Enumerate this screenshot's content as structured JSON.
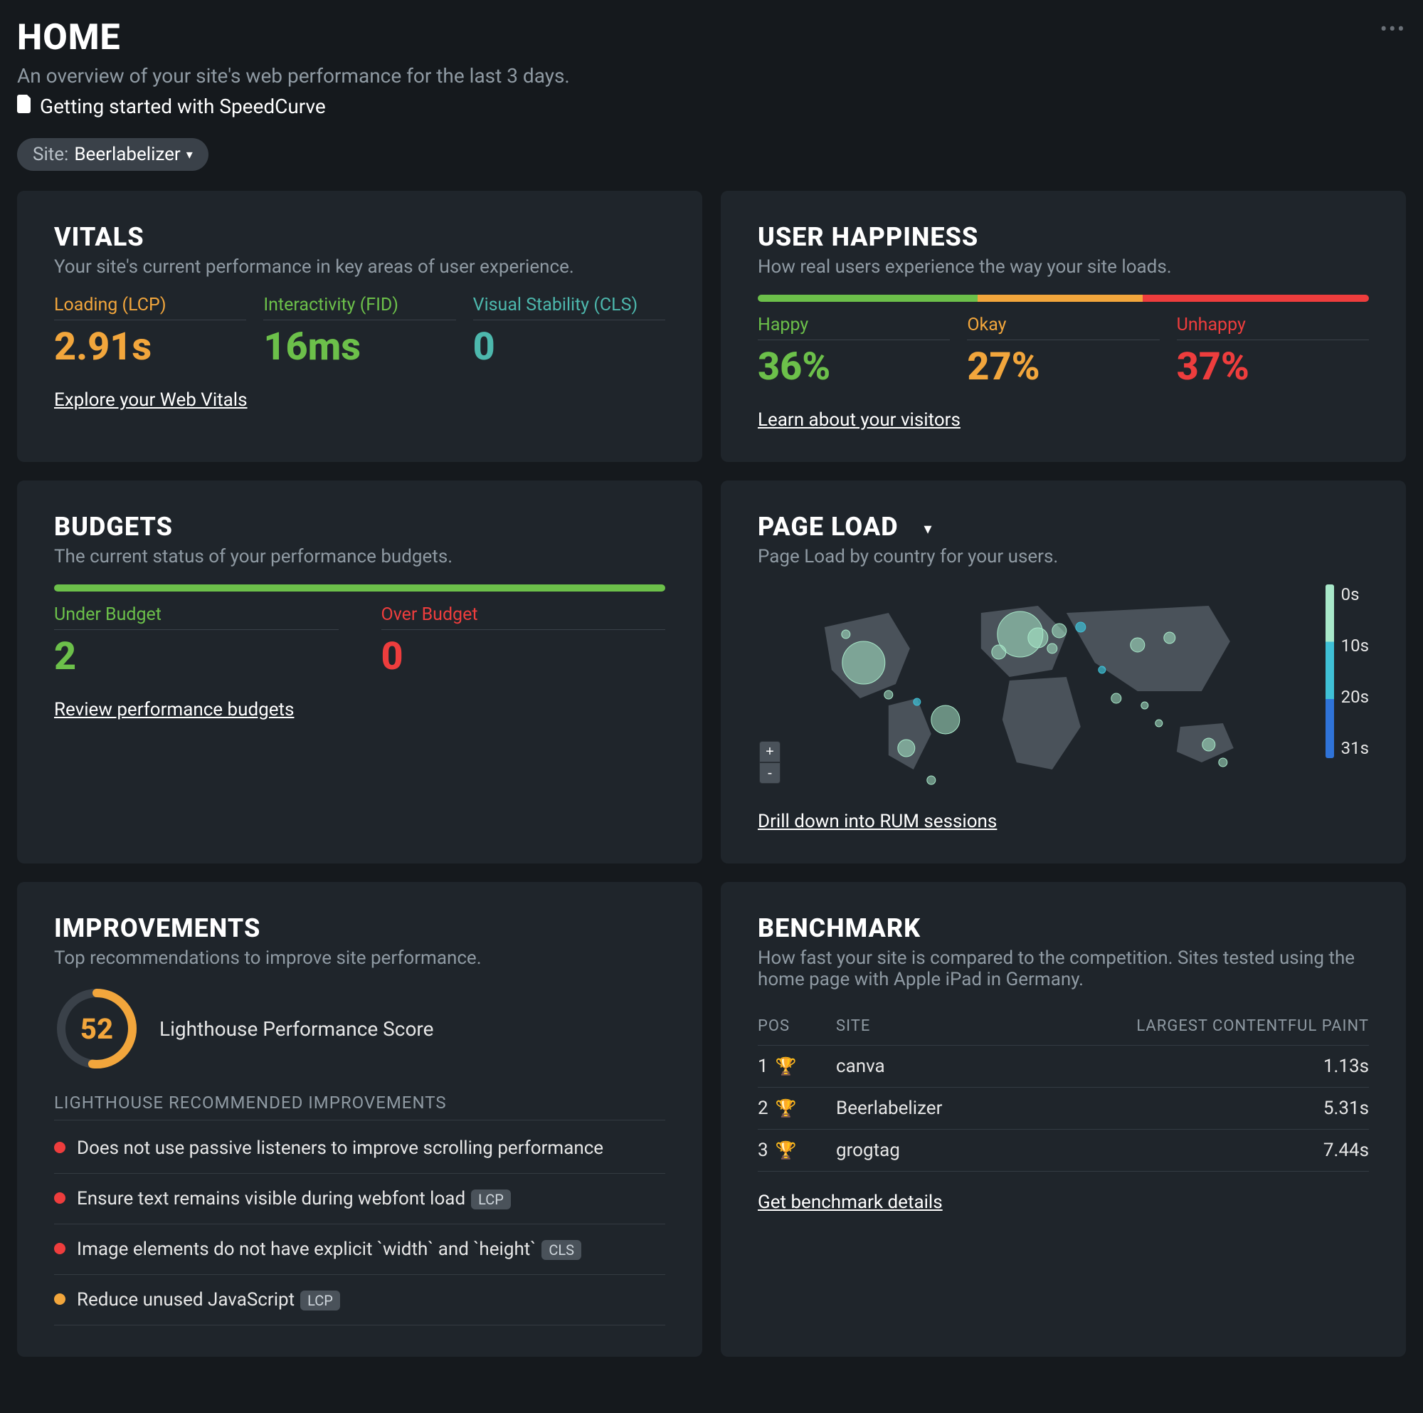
{
  "header": {
    "title": "HOME",
    "subtitle": "An overview of your site's web performance for the last 3 days.",
    "doc_link": "Getting started with SpeedCurve"
  },
  "site_selector": {
    "label": "Site:",
    "value": "Beerlabelizer"
  },
  "vitals": {
    "title": "VITALS",
    "desc": "Your site's current performance in key areas of user experience.",
    "metrics": [
      {
        "label": "Loading (LCP)",
        "value": "2.91s",
        "color": "c-orange"
      },
      {
        "label": "Interactivity (FID)",
        "value": "16ms",
        "color": "c-green"
      },
      {
        "label": "Visual Stability (CLS)",
        "value": "0",
        "color": "c-teal"
      }
    ],
    "link": "Explore your Web Vitals"
  },
  "user_happiness": {
    "title": "USER HAPPINESS",
    "desc": "How real users experience the way your site loads.",
    "bars": {
      "happy": 36,
      "okay": 27,
      "unhappy": 37
    },
    "metrics": [
      {
        "label": "Happy",
        "value": "36%",
        "color": "c-green"
      },
      {
        "label": "Okay",
        "value": "27%",
        "color": "c-orange"
      },
      {
        "label": "Unhappy",
        "value": "37%",
        "color": "c-red"
      }
    ],
    "link": "Learn about your visitors"
  },
  "budgets": {
    "title": "BUDGETS",
    "desc": "The current status of your performance budgets.",
    "metrics": [
      {
        "label": "Under Budget",
        "value": "2",
        "color": "c-green"
      },
      {
        "label": "Over Budget",
        "value": "0",
        "color": "c-red"
      }
    ],
    "link": "Review performance budgets"
  },
  "improvements": {
    "title": "IMPROVEMENTS",
    "desc": "Top recommendations to improve site performance.",
    "score": 52,
    "score_label": "Lighthouse Performance Score",
    "sub_heading": "LIGHTHOUSE RECOMMENDED IMPROVEMENTS",
    "items": [
      {
        "dot": "red",
        "text": "Does not use passive listeners to improve scrolling performance",
        "badge": null
      },
      {
        "dot": "red",
        "text": "Ensure text remains visible during webfont load",
        "badge": "LCP"
      },
      {
        "dot": "red",
        "text": "Image elements do not have explicit `width` and `height`",
        "badge": "CLS"
      },
      {
        "dot": "orange",
        "text": "Reduce unused JavaScript",
        "badge": "LCP"
      }
    ]
  },
  "page_load": {
    "title": "PAGE LOAD",
    "desc": "Page Load by country for your users.",
    "legend": [
      "0s",
      "10s",
      "20s",
      "31s"
    ],
    "link": "Drill down into RUM sessions"
  },
  "benchmark": {
    "title": "BENCHMARK",
    "desc": "How fast your site is compared to the competition. Sites tested using the home page with Apple iPad in Germany.",
    "cols": {
      "pos": "POS",
      "site": "SITE",
      "lcp": "LARGEST CONTENTFUL PAINT"
    },
    "rows": [
      {
        "pos": "1",
        "trophy": "t-gold",
        "site": "canva",
        "lcp": "1.13s"
      },
      {
        "pos": "2",
        "trophy": "t-silver",
        "site": "Beerlabelizer",
        "lcp": "5.31s"
      },
      {
        "pos": "3",
        "trophy": "t-bronze",
        "site": "grogtag",
        "lcp": "7.44s"
      }
    ],
    "link": "Get benchmark details"
  }
}
